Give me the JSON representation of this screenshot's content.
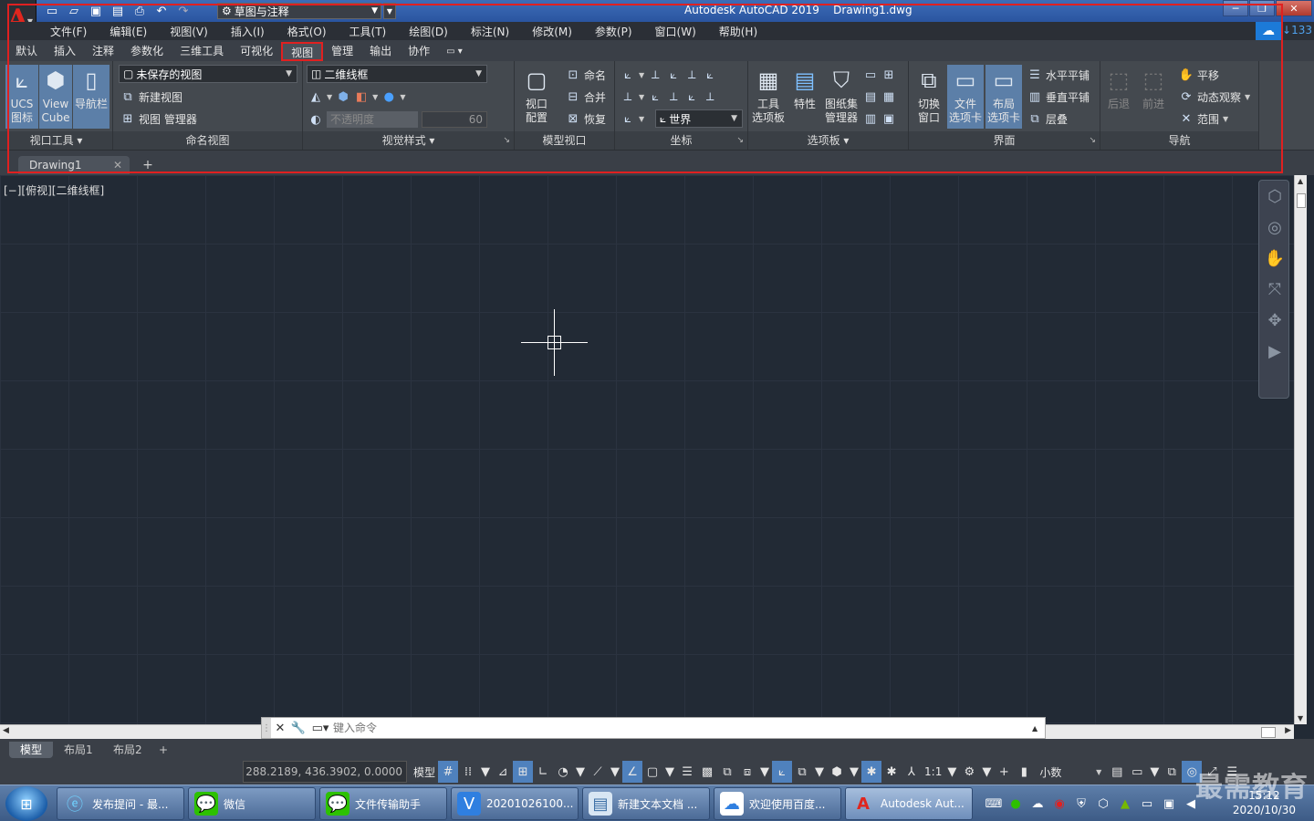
{
  "titlebar": {
    "workspace": "草图与注释",
    "title": "Autodesk AutoCAD 2019    Drawing1.dwg",
    "cloud_count": "133"
  },
  "menu": [
    "文件(F)",
    "编辑(E)",
    "视图(V)",
    "插入(I)",
    "格式(O)",
    "工具(T)",
    "绘图(D)",
    "标注(N)",
    "修改(M)",
    "参数(P)",
    "窗口(W)",
    "帮助(H)"
  ],
  "ribbon_tabs": [
    "默认",
    "插入",
    "注释",
    "参数化",
    "三维工具",
    "可视化",
    "视图",
    "管理",
    "输出",
    "协作"
  ],
  "active_tab": "视图",
  "ribbon": {
    "viewport_tools": {
      "title": "视口工具",
      "ucs": "UCS\n图标",
      "viewcube": "View\nCube",
      "navbar": "导航栏"
    },
    "named_views": {
      "title": "命名视图",
      "combo": "未保存的视图",
      "new": "新建视图",
      "manager": "视图 管理器"
    },
    "visual_styles": {
      "title": "视觉样式",
      "combo": "二维线框",
      "opacity": "不透明度",
      "opacity_value": "60"
    },
    "model_viewports": {
      "title": "模型视口",
      "config": "视口\n配置",
      "name": "命名",
      "join": "合并",
      "restore": "恢复"
    },
    "coordinates": {
      "title": "坐标",
      "world": "世界"
    },
    "palettes": {
      "title": "选项板",
      "tool": "工具\n选项板",
      "props": "特性",
      "sheetset": "图纸集\n管理器"
    },
    "interface": {
      "title": "界面",
      "switch": "切换\n窗口",
      "filetab": "文件\n选项卡",
      "layouttab": "布局\n选项卡",
      "tile_h": "水平平铺",
      "tile_v": "垂直平铺",
      "cascade": "层叠"
    },
    "navigate": {
      "title": "导航",
      "back": "后退",
      "forward": "前进",
      "pan": "平移",
      "orbit": "动态观察",
      "extents": "范围"
    }
  },
  "doc_tab": "Drawing1",
  "viewport_label": "[−][俯视][二维线框]",
  "command": {
    "placeholder": "键入命令"
  },
  "layout_tabs": [
    "模型",
    "布局1",
    "布局2"
  ],
  "status": {
    "coords": "288.2189, 436.3902, 0.0000",
    "model": "模型",
    "scale": "1:1",
    "units": "小数"
  },
  "taskbar": [
    {
      "label": "发布提问 - 最...",
      "icon": "ie-icon"
    },
    {
      "label": "微信",
      "icon": "wechat-icon"
    },
    {
      "label": "文件传输助手",
      "icon": "wechat-icon"
    },
    {
      "label": "20201026100...",
      "icon": "video-icon"
    },
    {
      "label": "新建文本文档 ...",
      "icon": "notepad-icon"
    },
    {
      "label": "欢迎使用百度...",
      "icon": "baidu-icon"
    },
    {
      "label": "Autodesk Aut...",
      "icon": "autocad-icon"
    }
  ],
  "clock": {
    "time": "15:12",
    "date": "2020/10/30"
  },
  "watermark": "最需教育"
}
